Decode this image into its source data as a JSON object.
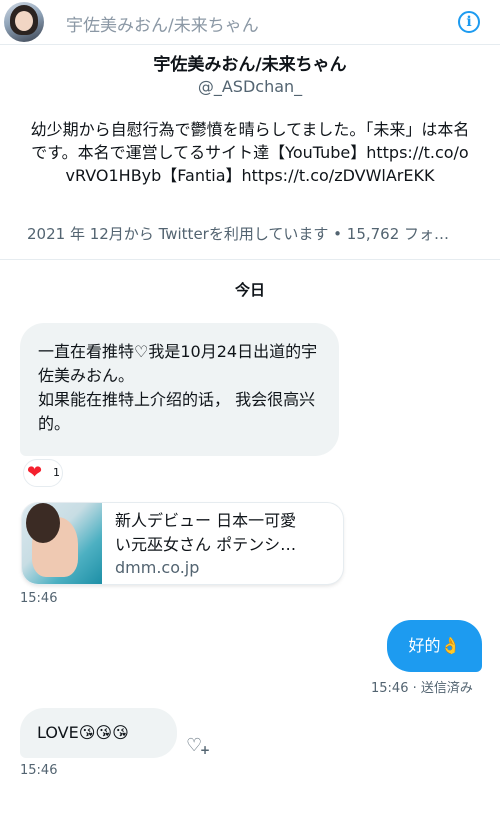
{
  "header": {
    "title": "宇佐美みおん/未来ちゃん",
    "info_icon": "info-icon"
  },
  "profile": {
    "name": "宇佐美みおん/未来ちゃん",
    "handle": "@_ASDchan_",
    "bio": "幼少期から自慰行為で鬱憤を晴らしてました。「未来」は本名です。本名で運営してるサイト達【YouTube】https://t.co/ovRVO1HByb【Fantia】https://t.co/zDVWlArEKK",
    "meta": "2021 年 12月から Twitterを利用しています • 15,762 フォ…"
  },
  "conversation": {
    "date_divider": "今日",
    "messages": [
      {
        "text": "一直在看推特♡我是10月24日出道的宇佐美みおん。\n如果能在推特上介绍的话， 我会很高兴的。",
        "reaction": {
          "emoji": "❤",
          "count": "1"
        }
      },
      {
        "card": {
          "title_line1": "新人デビュー 日本一可愛",
          "title_line2": "い元巫女さん ポテンシ…",
          "domain": "dmm.co.jp"
        },
        "time": "15:46"
      },
      {
        "outgoing_text": "好的👌",
        "time_status": "15:46 · 送信済み"
      },
      {
        "text": "LOVE😘😘😘",
        "time": "15:46"
      }
    ]
  },
  "colors": {
    "accent": "#1d9bf0",
    "bubble_in": "#eff3f4",
    "heart": "#f4212e",
    "secondary_text": "#536471"
  }
}
